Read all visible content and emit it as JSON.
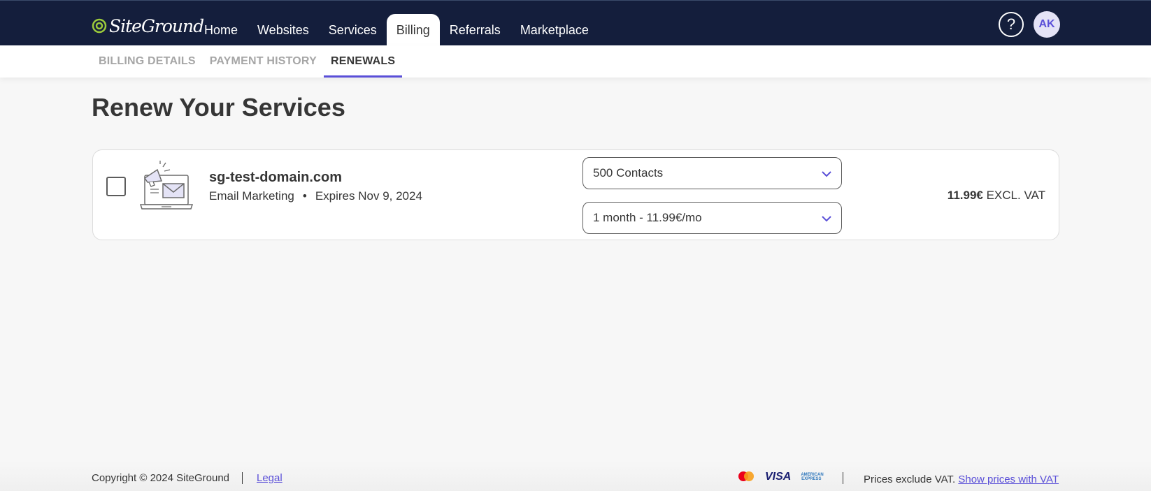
{
  "header": {
    "logo_text": "SiteGround",
    "nav": [
      {
        "label": "Home"
      },
      {
        "label": "Websites"
      },
      {
        "label": "Services"
      },
      {
        "label": "Billing",
        "active": true
      },
      {
        "label": "Referrals"
      },
      {
        "label": "Marketplace"
      }
    ],
    "help_label": "?",
    "avatar_initials": "AK"
  },
  "subtabs": [
    {
      "label": "BILLING DETAILS"
    },
    {
      "label": "PAYMENT HISTORY"
    },
    {
      "label": "RENEWALS",
      "active": true
    }
  ],
  "page_title": "Renew Your Services",
  "service": {
    "domain": "sg-test-domain.com",
    "type": "Email Marketing",
    "separator": "•",
    "expires": "Expires Nov 9, 2024",
    "checked": false,
    "plan_select": "500 Contacts",
    "period_select": "1 month - 11.99€/mo",
    "price_amount": "11.99€",
    "price_suffix": "EXCL. VAT",
    "illustration_icon": "email-marketing-illustration"
  },
  "footer": {
    "copyright": "Copyright © 2024 SiteGround",
    "legal_label": "Legal",
    "visa_label": "VISA",
    "amex_label": "AMERICAN EXPRESS",
    "vat_text": "Prices exclude VAT.",
    "vat_link": "Show prices with VAT"
  },
  "colors": {
    "nav_bg": "#141e3c",
    "accent": "#5a4fd8",
    "text": "#363636"
  }
}
